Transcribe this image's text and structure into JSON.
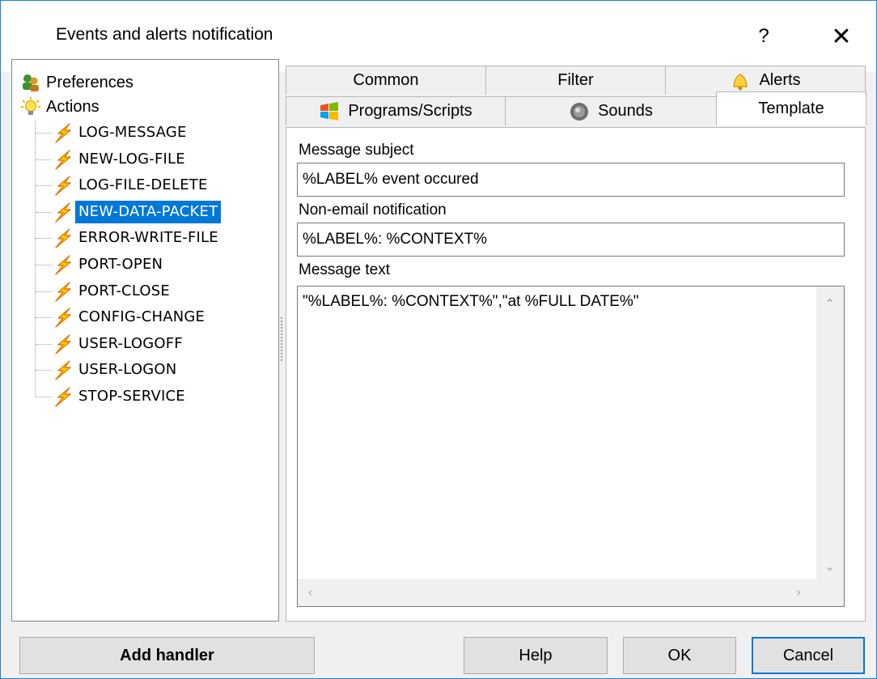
{
  "window": {
    "title": "Events and alerts notification",
    "help_label": "?",
    "close_label": "✕"
  },
  "tree": {
    "root_items": [
      {
        "label": "Preferences",
        "icon": "users-preferences-icon"
      },
      {
        "label": "Actions",
        "icon": "lightbulb-icon"
      }
    ],
    "actions": [
      {
        "label": "LOG-MESSAGE"
      },
      {
        "label": "NEW-LOG-FILE"
      },
      {
        "label": "LOG-FILE-DELETE"
      },
      {
        "label": "NEW-DATA-PACKET",
        "selected": true
      },
      {
        "label": "ERROR-WRITE-FILE"
      },
      {
        "label": "PORT-OPEN"
      },
      {
        "label": "PORT-CLOSE"
      },
      {
        "label": "CONFIG-CHANGE"
      },
      {
        "label": "USER-LOGOFF"
      },
      {
        "label": "USER-LOGON"
      },
      {
        "label": "STOP-SERVICE"
      }
    ],
    "action_icon": "lightning-bolt-icon"
  },
  "tabs": {
    "row1": [
      "Common",
      "Filter",
      "Alerts"
    ],
    "row2": [
      "Programs/Scripts",
      "Sounds",
      "Template"
    ],
    "active": "Template"
  },
  "template": {
    "subject_label": "Message subject",
    "subject_value": "%LABEL% event occured",
    "nonemail_label": "Non-email notification",
    "nonemail_value": "%LABEL%: %CONTEXT%",
    "text_label": "Message text",
    "text_value": "\"%LABEL%: %CONTEXT%\",\"at %FULL DATE%\""
  },
  "buttons": {
    "add_handler": "Add handler",
    "help": "Help",
    "ok": "OK",
    "cancel": "Cancel"
  },
  "colors": {
    "selection": "#0078d7",
    "window_border": "#1883d7"
  }
}
